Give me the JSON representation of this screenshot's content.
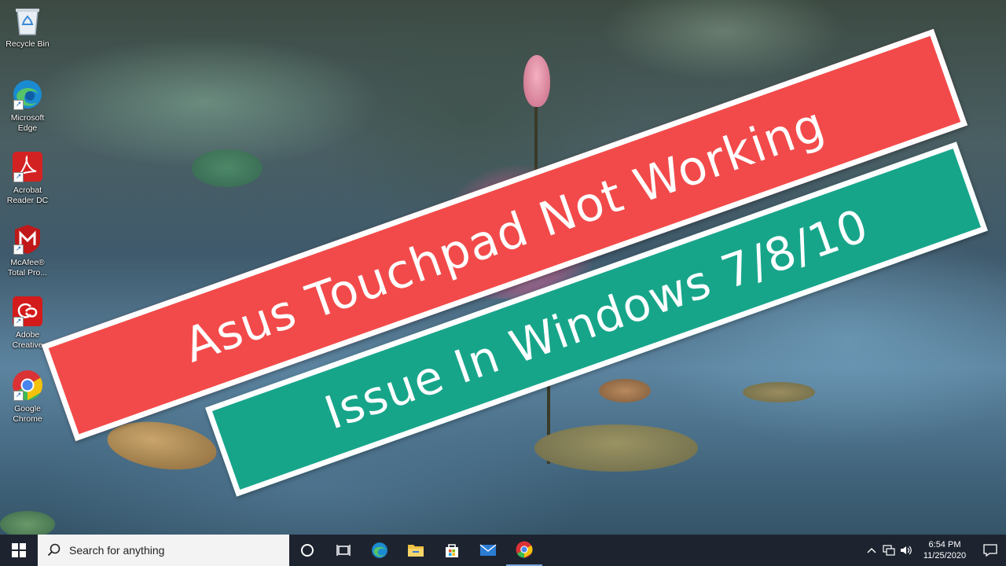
{
  "desktop_icons": [
    {
      "label": "Recycle Bin",
      "icon": "recycle-bin-icon"
    },
    {
      "label": "Microsoft\nEdge",
      "icon": "edge-icon"
    },
    {
      "label": "Acrobat\nReader DC",
      "icon": "acrobat-icon"
    },
    {
      "label": "McAfee®\nTotal Pro...",
      "icon": "mcafee-icon"
    },
    {
      "label": "Adobe\nCreative",
      "icon": "adobe-cc-icon"
    },
    {
      "label": "Google\nChrome",
      "icon": "chrome-icon"
    }
  ],
  "banner": {
    "line1": "Asus Touchpad Not Working",
    "line2": "Issue In Windows 7/8/10",
    "colors": {
      "red": "#f24a4a",
      "green": "#17a58a",
      "border": "#ffffff"
    }
  },
  "taskbar": {
    "search_placeholder": "Search for anything",
    "pinned": [
      "cortana-icon",
      "task-view-icon",
      "edge-icon",
      "file-explorer-icon",
      "store-icon",
      "mail-icon",
      "chrome-icon"
    ],
    "clock": {
      "time": "6:54 PM",
      "date": "11/25/2020"
    }
  }
}
